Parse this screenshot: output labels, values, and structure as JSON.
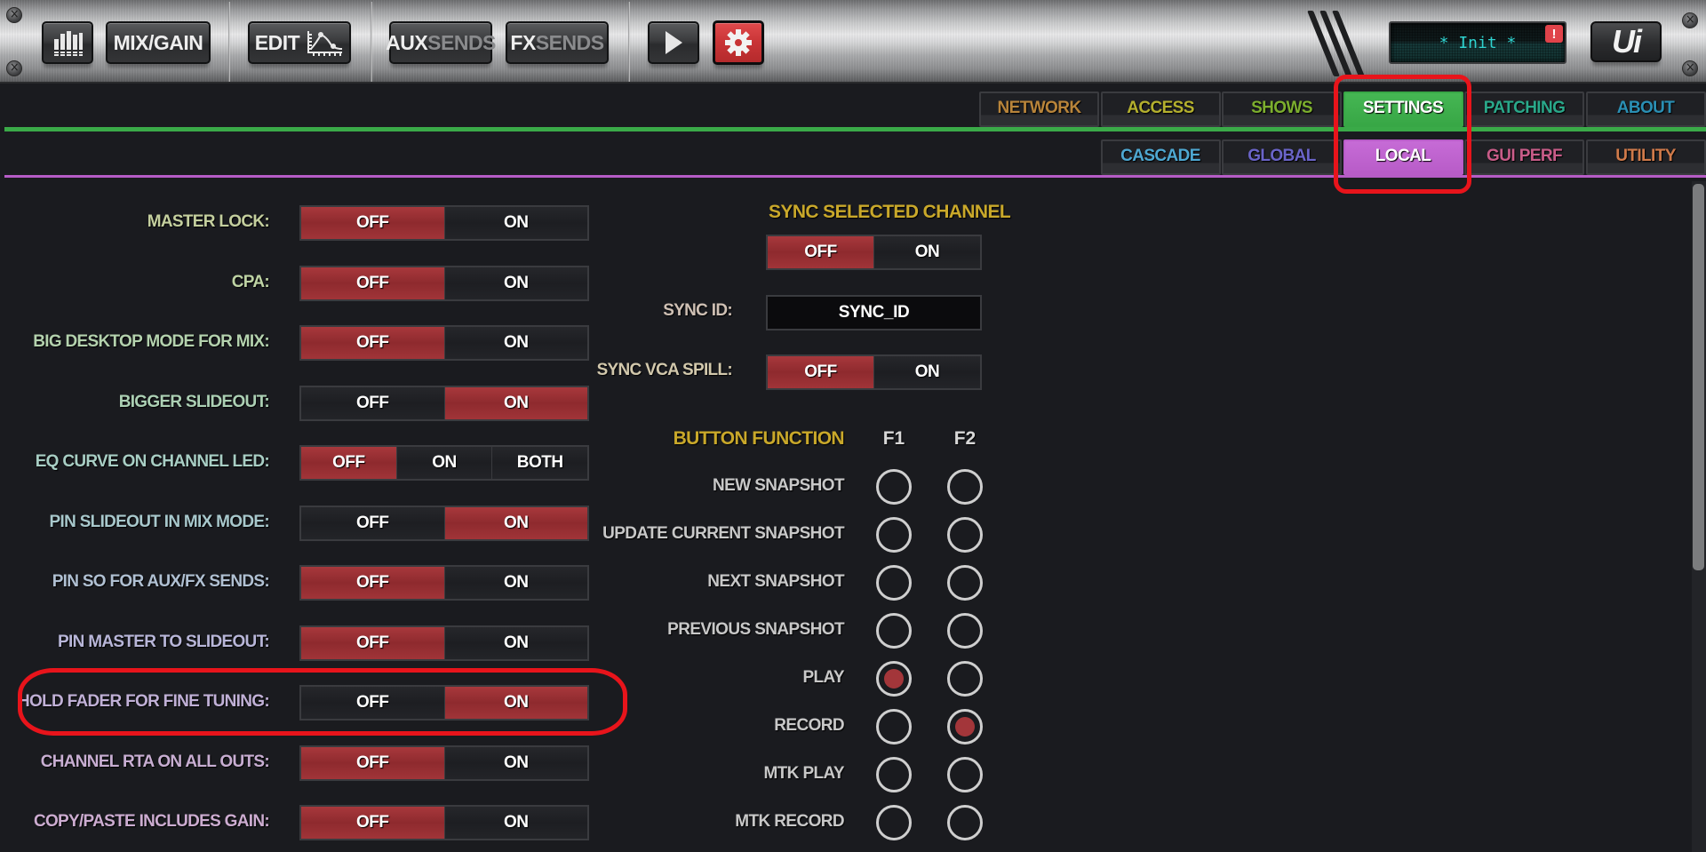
{
  "toolbar": {
    "meters_button": {
      "icon": "meter-bars-icon"
    },
    "mix_gain_label": "MIX/GAIN",
    "edit_label": "EDIT",
    "edit_icon": "eq-curve-icon",
    "aux_sends": {
      "bright": "AUX",
      "dim": "SENDS"
    },
    "fx_sends": {
      "bright": "FX",
      "dim": "SENDS"
    },
    "play_icon": "play-icon",
    "settings_icon": "gear-icon",
    "display_text": "* Init *",
    "alert_badge": "!",
    "logo_text": "Ui"
  },
  "main_tabs": [
    {
      "label": "NETWORK",
      "color": "#b8843a",
      "active": false
    },
    {
      "label": "ACCESS",
      "color": "#b4b02e",
      "active": false
    },
    {
      "label": "SHOWS",
      "color": "#7cae2e",
      "active": false
    },
    {
      "label": "SETTINGS",
      "color": "#ffffff",
      "active": true
    },
    {
      "label": "PATCHING",
      "color": "#2aa88a",
      "active": false
    },
    {
      "label": "ABOUT",
      "color": "#2a8fb4",
      "active": false
    }
  ],
  "sub_tabs": [
    {
      "label": "CASCADE",
      "color": "#4ea8d2",
      "active": false
    },
    {
      "label": "GLOBAL",
      "color": "#6a64c8",
      "active": false
    },
    {
      "label": "LOCAL",
      "color": "#ffffff",
      "active": true
    },
    {
      "label": "GUI PERF",
      "color": "#c85c88",
      "active": false
    },
    {
      "label": "UTILITY",
      "color": "#d07a4a",
      "active": false
    }
  ],
  "settings": [
    {
      "label": "MASTER LOCK:",
      "color": "#c4cf9e",
      "options": [
        "OFF",
        "ON"
      ],
      "selected": "OFF"
    },
    {
      "label": "CPA:",
      "color": "#bed3a4",
      "options": [
        "OFF",
        "ON"
      ],
      "selected": "OFF"
    },
    {
      "label": "BIG DESKTOP MODE FOR MIX:",
      "color": "#b4d2ae",
      "options": [
        "OFF",
        "ON"
      ],
      "selected": "OFF"
    },
    {
      "label": "BIGGER SLIDEOUT:",
      "color": "#acd0b4",
      "options": [
        "OFF",
        "ON"
      ],
      "selected": "ON"
    },
    {
      "label": "EQ CURVE ON CHANNEL LED:",
      "color": "#a8cec4",
      "options": [
        "OFF",
        "ON",
        "BOTH"
      ],
      "selected": "OFF"
    },
    {
      "label": "PIN SLIDEOUT IN MIX MODE:",
      "color": "#a8c8cc",
      "options": [
        "OFF",
        "ON"
      ],
      "selected": "ON"
    },
    {
      "label": "PIN SO FOR AUX/FX SENDS:",
      "color": "#b0c0d2",
      "options": [
        "OFF",
        "ON"
      ],
      "selected": "OFF"
    },
    {
      "label": "PIN MASTER TO SLIDEOUT:",
      "color": "#b8b6d8",
      "options": [
        "OFF",
        "ON"
      ],
      "selected": "OFF"
    },
    {
      "label": "HOLD FADER FOR FINE TUNING:",
      "color": "#c0b0d6",
      "options": [
        "OFF",
        "ON"
      ],
      "selected": "ON"
    },
    {
      "label": "CHANNEL RTA ON ALL OUTS:",
      "color": "#c8aed2",
      "options": [
        "OFF",
        "ON"
      ],
      "selected": "OFF"
    },
    {
      "label": "COPY/PASTE INCLUDES GAIN:",
      "color": "#ccacd0",
      "options": [
        "OFF",
        "ON"
      ],
      "selected": "OFF"
    }
  ],
  "sync": {
    "title": "SYNC SELECTED CHANNEL",
    "channel_toggle": {
      "options": [
        "OFF",
        "ON"
      ],
      "selected": "OFF"
    },
    "id_label": "SYNC ID:",
    "id_label_color": "#cfc0b4",
    "id_value": "SYNC_ID",
    "vca_label": "SYNC VCA SPILL:",
    "vca_label_color": "#d2c8ac",
    "vca_toggle": {
      "options": [
        "OFF",
        "ON"
      ],
      "selected": "OFF"
    }
  },
  "button_function": {
    "title": "BUTTON FUNCTION",
    "columns": [
      "F1",
      "F2"
    ],
    "rows": [
      {
        "label": "NEW SNAPSHOT",
        "f1": false,
        "f2": false
      },
      {
        "label": "UPDATE CURRENT SNAPSHOT",
        "f1": false,
        "f2": false
      },
      {
        "label": "NEXT SNAPSHOT",
        "f1": false,
        "f2": false
      },
      {
        "label": "PREVIOUS SNAPSHOT",
        "f1": false,
        "f2": false
      },
      {
        "label": "PLAY",
        "f1": true,
        "f2": false
      },
      {
        "label": "RECORD",
        "f1": false,
        "f2": true
      },
      {
        "label": "MTK PLAY",
        "f1": false,
        "f2": false
      },
      {
        "label": "MTK RECORD",
        "f1": false,
        "f2": false
      }
    ]
  },
  "colors": {
    "accent_green": "#3aaa48",
    "accent_purple": "#b65cc6",
    "toggle_on": "#9a3236",
    "annotation_red": "#e8141b",
    "lcd_text": "#2fd3d0"
  }
}
